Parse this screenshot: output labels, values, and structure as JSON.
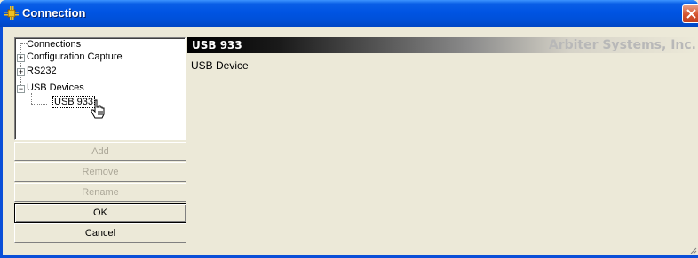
{
  "window": {
    "title": "Connection",
    "icon": "connection-plug-icon",
    "close_icon": "close-icon"
  },
  "tree": {
    "items": [
      {
        "label": "Connections",
        "expander": ""
      },
      {
        "label": "Configuration Capture",
        "expander": "+"
      },
      {
        "label": "RS232",
        "expander": "+"
      },
      {
        "label": "USB Devices",
        "expander": "−"
      },
      {
        "label": "USB 933",
        "expander": "",
        "selected": true
      }
    ]
  },
  "buttons": {
    "add": "Add",
    "remove": "Remove",
    "rename": "Rename",
    "ok": "OK",
    "cancel": "Cancel"
  },
  "detail": {
    "device_name": "USB 933",
    "company": "Arbiter Systems, Inc.",
    "device_type": "USB Device"
  },
  "colors": {
    "titlebar": "#0054e3",
    "face": "#ece9d8",
    "close": "#d5532f"
  }
}
